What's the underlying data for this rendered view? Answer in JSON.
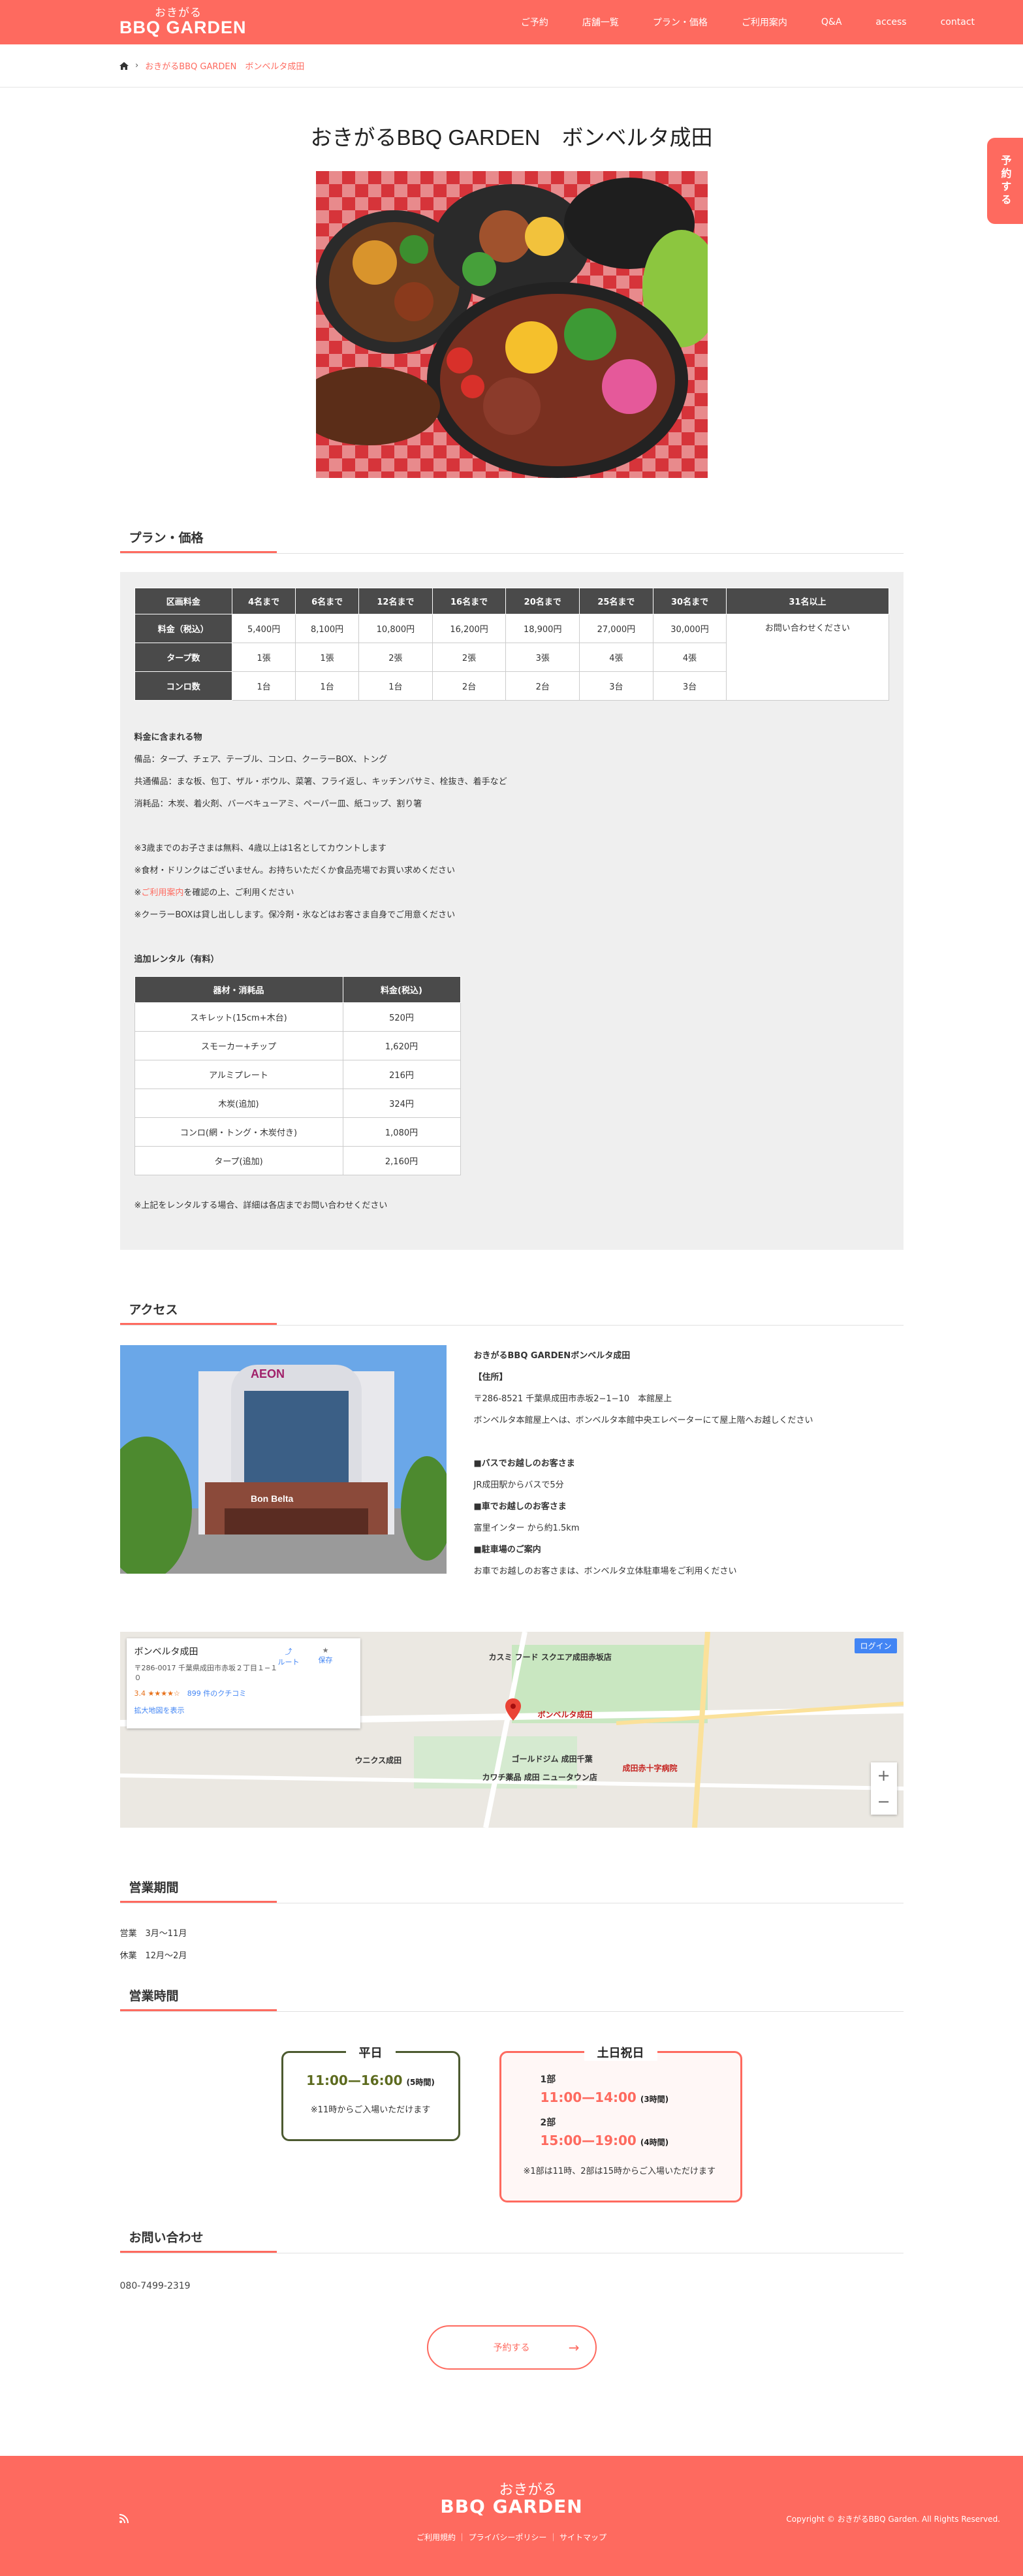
{
  "header": {
    "logo_small": "おきがる",
    "logo_big": "BBQ GARDEN",
    "nav": [
      "ご予約",
      "店舗一覧",
      "プラン・価格",
      "ご利用案内",
      "Q&A",
      "access",
      "contact"
    ]
  },
  "breadcrumb": {
    "current": "おきがるBBQ GARDEN　ボンベルタ成田"
  },
  "page_title": "おきがるBBQ GARDEN　ボンベルタ成田",
  "side_tab": "予約する",
  "plan": {
    "heading": "プラン・価格",
    "columns": [
      "区画料金",
      "4名まで",
      "6名まで",
      "12名まで",
      "16名まで",
      "20名まで",
      "25名まで",
      "30名まで",
      "31名以上"
    ],
    "rows": [
      {
        "label": "料金（税込）",
        "values": [
          "5,400円",
          "8,100円",
          "10,800円",
          "16,200円",
          "18,900円",
          "27,000円",
          "30,000円"
        ]
      },
      {
        "label": "タープ数",
        "values": [
          "1張",
          "1張",
          "2張",
          "2張",
          "3張",
          "4張",
          "4張"
        ]
      },
      {
        "label": "コンロ数",
        "values": [
          "1台",
          "1台",
          "1台",
          "2台",
          "2台",
          "3台",
          "3台"
        ]
      }
    ],
    "last_col": "お問い合わせください",
    "included_title": "料金に含まれる物",
    "included": [
      "備品：タープ、チェア、テーブル、コンロ、クーラーBOX、トング",
      "共通備品：まな板、包丁、ザル・ボウル、菜箸、フライ返し、キッチンバサミ、栓抜き、着手など",
      "消耗品：木炭、着火剤、バーベキューアミ、ペーパー皿、紙コップ、割り箸"
    ],
    "notes": [
      "※3歳までのお子さまは無料、4歳以上は1名としてカウントします",
      "※食材・ドリンクはございません。お持ちいただくか食品売場でお買い求めください"
    ],
    "note_link": "ご利用案内",
    "note_link_suffix": "を確認の上、ご利用ください",
    "note_link_prefix": "※",
    "note_last": "※クーラーBOXは貸し出しします。保冷剤・氷などはお客さま自身でご用意ください",
    "rental_title": "追加レンタル（有料）",
    "rental_headers": [
      "器材・消耗品",
      "料金(税込)"
    ],
    "rental": [
      {
        "item": "スキレット(15cm+木台)",
        "price": "520円"
      },
      {
        "item": "スモーカー+チップ",
        "price": "1,620円"
      },
      {
        "item": "アルミプレート",
        "price": "216円"
      },
      {
        "item": "木炭(追加)",
        "price": "324円"
      },
      {
        "item": "コンロ(網・トング・木炭付き)",
        "price": "1,080円"
      },
      {
        "item": "タープ(追加)",
        "price": "2,160円"
      }
    ],
    "rental_note": "※上記をレンタルする場合、詳細は各店までお問い合わせください"
  },
  "access": {
    "heading": "アクセス",
    "name": "おきがるBBQ GARDENボンベルタ成田",
    "addr_title": "【住所】",
    "addr": "〒286-8521 千葉県成田市赤坂2−1−10　本館屋上",
    "addr_note": "ボンベルタ本館屋上へは、ボンベルタ本館中央エレベーターにて屋上階へお越しください",
    "bus_title": "■バスでお越しのお客さま",
    "bus": "JR成田駅からバスで5分",
    "car_title": "■車でお越しのお客さま",
    "car": "富里インター から約1.5km",
    "parking_title": "■駐車場のご案内",
    "parking": "お車でお越しのお客さまは、ボンベルタ立体駐車場をご利用ください",
    "photo_sign": "Bon Belta",
    "photo_logo": "AEON"
  },
  "map": {
    "place": "ボンベルタ成田",
    "address": "〒286-0017 千葉県成田市赤坂２丁目１−１０",
    "rating": "3.4 ★★★★☆",
    "reviews": "899 件のクチコミ",
    "enlarge": "拡大地図を表示",
    "route": "ルート",
    "save": "保存",
    "login": "ログイン",
    "labels": [
      "カスミ フード スクエア成田赤坂店",
      "ボンベルタ成田",
      "ウニクス成田",
      "ゴールドジム 成田千葉",
      "カワチ薬品 成田 ニュータウン店",
      "成田赤十字病院"
    ],
    "zoom_in": "+",
    "zoom_out": "−"
  },
  "season": {
    "heading": "営業期間",
    "open": "営業　3月〜11月",
    "closed": "休業　12月〜2月"
  },
  "hours": {
    "heading": "営業時間",
    "weekday_title": "平日",
    "weekday_time": "11:00—16:00",
    "weekday_dur": "(5時間)",
    "weekday_note": "※11時からご入場いただけます",
    "weekend_title": "土日祝日",
    "part1": "1部",
    "part1_time": "11:00—14:00",
    "part1_dur": "(3時間)",
    "part2": "2部",
    "part2_time": "15:00—19:00",
    "part2_dur": "(4時間)",
    "weekend_note": "※1部は11時、2部は15時からご入場いただけます"
  },
  "contact": {
    "heading": "お問い合わせ",
    "tel": "080-7499-2319",
    "button": "予約する"
  },
  "footer": {
    "logo_small": "おきがる",
    "logo_big": "BBQ GARDEN",
    "links": "ご利用規約 ｜ プライバシーポリシー ｜ サイトマップ",
    "copyright": "Copyright © おきがるBBQ Garden. All Rights Reserved."
  },
  "colors": {
    "accent": "#fe6a5f",
    "dark": "#4a4a4a",
    "weekday": "#4c5a30"
  }
}
